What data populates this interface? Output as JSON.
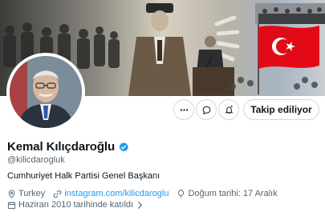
{
  "profile": {
    "name": "Kemal Kılıçdaroğlu",
    "handle": "@kilicdarogluk",
    "bio": "Cumhuriyet Halk Partisi Genel Başkanı",
    "location": "Turkey",
    "website": "instagram.com/kilicdaroglu",
    "birthday": "Doğum tarihi: 17 Aralık",
    "joined": "Haziran 2010 tarihinde katıldı"
  },
  "actions": {
    "follow_label": "Takip ediliyor"
  },
  "icons": {
    "more": "more-icon",
    "message": "message-icon",
    "notify": "notification-icon",
    "verified": "verified-badge-icon",
    "location": "location-icon",
    "link": "link-icon",
    "birthday": "balloon-icon",
    "calendar": "calendar-icon"
  },
  "colors": {
    "accent": "#1d9bf0",
    "text": "#0f1419",
    "muted": "#536471",
    "border": "#cfd9de",
    "flag": "#e30a17"
  }
}
